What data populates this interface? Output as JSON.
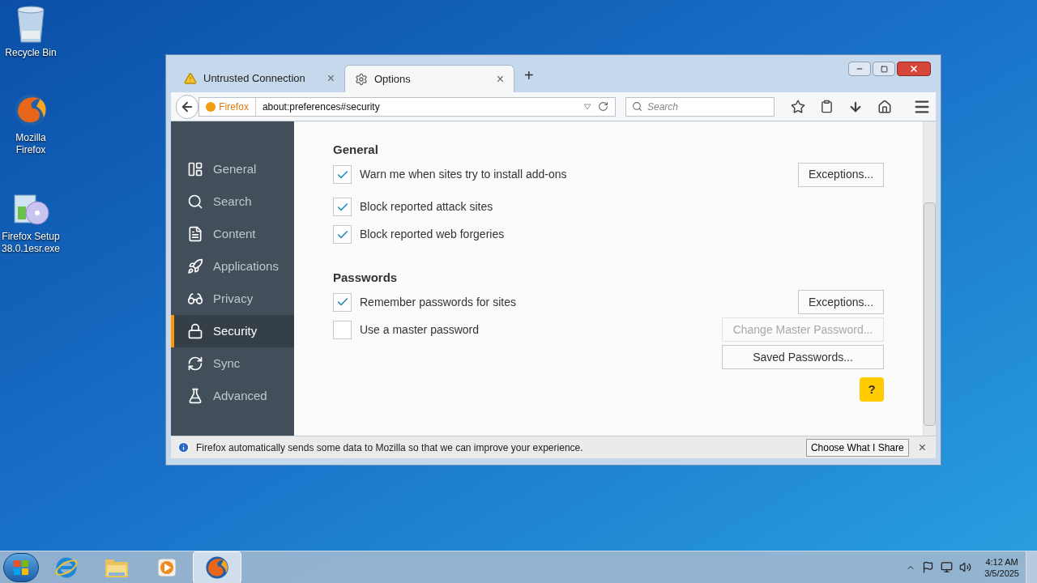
{
  "desktop_icons": [
    {
      "label": "Recycle Bin",
      "kind": "bin"
    },
    {
      "label": "Mozilla Firefox",
      "kind": "firefox"
    },
    {
      "label": "Firefox Setup 38.0.1esr.exe",
      "kind": "setup"
    }
  ],
  "window": {
    "tabs": [
      {
        "label": "Untrusted Connection",
        "selected": false,
        "kind": "warning",
        "close": "×"
      },
      {
        "label": "Options",
        "selected": true,
        "kind": "gear",
        "close": "×"
      }
    ],
    "new_tab": "+",
    "url_bar": {
      "identity": "Firefox",
      "url": "about:preferences#security"
    },
    "search": {
      "placeholder": "Search"
    },
    "sidebar": {
      "items": [
        {
          "label": "General",
          "selected": false,
          "kind": "general"
        },
        {
          "label": "Search",
          "selected": false,
          "kind": "search"
        },
        {
          "label": "Content",
          "selected": false,
          "kind": "content"
        },
        {
          "label": "Applications",
          "selected": false,
          "kind": "applications"
        },
        {
          "label": "Privacy",
          "selected": false,
          "kind": "privacy"
        },
        {
          "label": "Security",
          "selected": true,
          "kind": "security"
        },
        {
          "label": "Sync",
          "selected": false,
          "kind": "sync"
        },
        {
          "label": "Advanced",
          "selected": false,
          "kind": "advanced"
        }
      ]
    },
    "sections": [
      {
        "title": "General",
        "rows": [
          {
            "label": "Warn me when sites try to install add-ons",
            "checked": true,
            "button": {
              "label": "Exceptions...",
              "disabled": false
            }
          },
          {
            "label": "Block reported attack sites",
            "checked": true
          },
          {
            "label": "Block reported web forgeries",
            "checked": true
          }
        ]
      },
      {
        "title": "Passwords",
        "rows": [
          {
            "label": "Remember passwords for sites",
            "checked": true,
            "button": {
              "label": "Exceptions...",
              "disabled": false
            }
          },
          {
            "label": "Use a master password",
            "checked": false,
            "button": {
              "label": "Change Master Password...",
              "disabled": true
            }
          }
        ]
      }
    ],
    "saved_passwords_button": "Saved Passwords...",
    "help_button": "?",
    "notification": {
      "text": "Firefox automatically sends some data to Mozilla so that we can improve your experience.",
      "button": "Choose What I Share",
      "close": "×"
    }
  },
  "taskbar": {
    "apps": [
      {
        "kind": "ie",
        "selected": false
      },
      {
        "kind": "explorer",
        "selected": false
      },
      {
        "kind": "media",
        "selected": false
      },
      {
        "kind": "firefox",
        "selected": true
      }
    ],
    "time": "4:12 AM",
    "date": "3/5/2025"
  }
}
